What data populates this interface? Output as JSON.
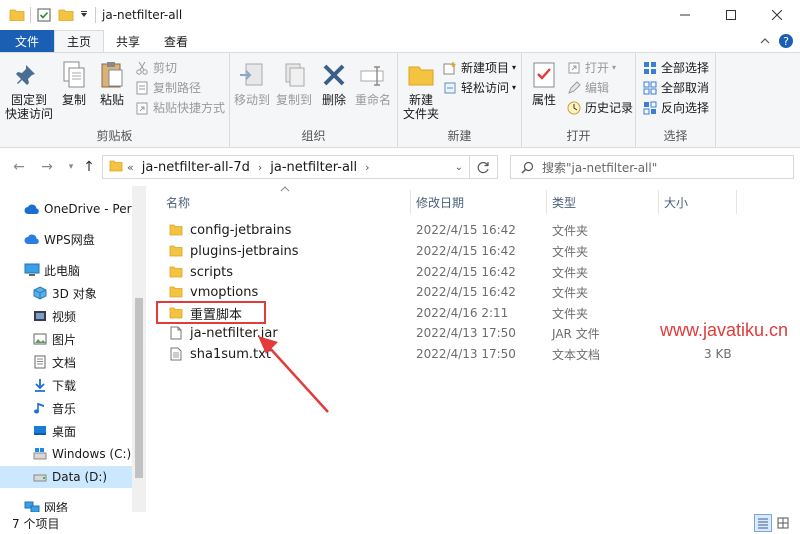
{
  "window": {
    "title": "ja-netfilter-all"
  },
  "ribbon_tabs": [
    {
      "label": "文件"
    },
    {
      "label": "主页"
    },
    {
      "label": "共享"
    },
    {
      "label": "查看"
    }
  ],
  "ribbon": {
    "clipboard": {
      "pin": "固定到\n快速访问",
      "copy": "复制",
      "paste": "粘贴",
      "cut": "剪切",
      "copy_path": "复制路径",
      "paste_shortcut": "粘贴快捷方式",
      "label": "剪贴板"
    },
    "organize": {
      "move_to": "移动到",
      "copy_to": "复制到",
      "delete": "删除",
      "rename": "重命名",
      "label": "组织"
    },
    "new": {
      "new_folder": "新建\n文件夹",
      "new_item": "新建项目",
      "easy_access": "轻松访问",
      "label": "新建"
    },
    "open": {
      "properties": "属性",
      "open": "打开",
      "edit": "编辑",
      "history": "历史记录",
      "label": "打开"
    },
    "select": {
      "select_all": "全部选择",
      "select_none": "全部取消",
      "invert": "反向选择",
      "label": "选择"
    }
  },
  "address": {
    "overflow": "«",
    "crumbs": [
      "ja-netfilter-all-7d",
      "ja-netfilter-all"
    ],
    "search_placeholder": "搜索\"ja-netfilter-all\""
  },
  "nav": [
    {
      "label": "OneDrive - Perso",
      "icon": "cloud-icon"
    },
    {
      "label": "WPS网盘",
      "icon": "cloud-icon"
    },
    {
      "label": "此电脑",
      "icon": "computer-icon"
    },
    {
      "label": "3D 对象",
      "icon": "cube-icon"
    },
    {
      "label": "视频",
      "icon": "video-icon"
    },
    {
      "label": "图片",
      "icon": "picture-icon"
    },
    {
      "label": "文档",
      "icon": "document-icon"
    },
    {
      "label": "下载",
      "icon": "download-icon"
    },
    {
      "label": "音乐",
      "icon": "music-icon"
    },
    {
      "label": "桌面",
      "icon": "desktop-icon"
    },
    {
      "label": "Windows (C:)",
      "icon": "drive-icon"
    },
    {
      "label": "Data (D:)",
      "icon": "drive-icon"
    },
    {
      "label": "网络",
      "icon": "network-icon"
    }
  ],
  "columns": {
    "name": "名称",
    "date": "修改日期",
    "type": "类型",
    "size": "大小"
  },
  "files": [
    {
      "name": "config-jetbrains",
      "date": "2022/4/15 16:42",
      "type": "文件夹",
      "size": "",
      "kind": "folder"
    },
    {
      "name": "plugins-jetbrains",
      "date": "2022/4/15 16:42",
      "type": "文件夹",
      "size": "",
      "kind": "folder"
    },
    {
      "name": "scripts",
      "date": "2022/4/15 16:42",
      "type": "文件夹",
      "size": "",
      "kind": "folder"
    },
    {
      "name": "vmoptions",
      "date": "2022/4/15 16:42",
      "type": "文件夹",
      "size": "",
      "kind": "folder"
    },
    {
      "name": "重置脚本",
      "date": "2022/4/16 2:11",
      "type": "文件夹",
      "size": "",
      "kind": "folder"
    },
    {
      "name": "ja-netfilter.jar",
      "date": "2022/4/13 17:50",
      "type": "JAR 文件",
      "size": "",
      "kind": "file"
    },
    {
      "name": "sha1sum.txt",
      "date": "2022/4/13 17:50",
      "type": "文本文档",
      "size": "3 KB",
      "kind": "file"
    }
  ],
  "watermark": "www.javatiku.cn",
  "status": {
    "count": "7 个项目"
  },
  "colors": {
    "accent": "#1a5fb4",
    "folder": "#f5c342",
    "highlight": "#e23b3b",
    "selected": "#cce8ff"
  }
}
